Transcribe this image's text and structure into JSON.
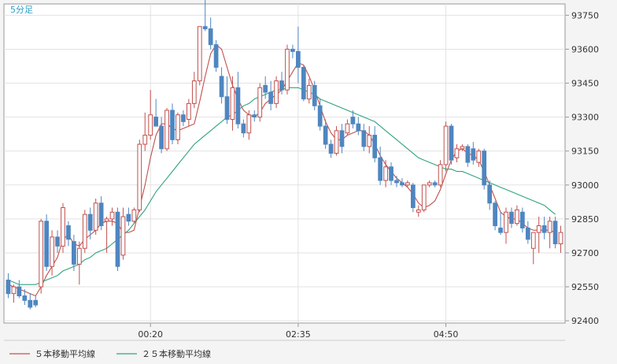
{
  "timeframe_label": "5分足",
  "chart_data": {
    "type": "candlestick",
    "timeframe": "5分足",
    "y_ticks": [
      92400,
      92550,
      92700,
      92850,
      93000,
      93150,
      93300,
      93450,
      93600,
      93750
    ],
    "ylim": [
      92390,
      93800
    ],
    "x_ticks": [
      {
        "label": "00:20",
        "index": 26
      },
      {
        "label": "02:35",
        "index": 53
      },
      {
        "label": "04:50",
        "index": 80
      }
    ],
    "grid": true,
    "legend_position": "bottom-left",
    "up_color": "#ffffff",
    "up_border": "#c0504d",
    "down_color": "#4f86c0",
    "candles": [
      [
        92580,
        92610,
        92500,
        92520
      ],
      [
        92520,
        92560,
        92480,
        92550
      ],
      [
        92550,
        92580,
        92500,
        92510
      ],
      [
        92510,
        92540,
        92470,
        92490
      ],
      [
        92490,
        92520,
        92450,
        92460
      ],
      [
        92490,
        92510,
        92460,
        92470
      ],
      [
        92550,
        92850,
        92520,
        92840
      ],
      [
        92840,
        92870,
        92620,
        92640
      ],
      [
        92640,
        92800,
        92600,
        92770
      ],
      [
        92770,
        92800,
        92700,
        92730
      ],
      [
        92730,
        92920,
        92700,
        92900
      ],
      [
        92820,
        92840,
        92730,
        92760
      ],
      [
        92750,
        92780,
        92620,
        92650
      ],
      [
        92650,
        92750,
        92560,
        92720
      ],
      [
        92720,
        92890,
        92700,
        92870
      ],
      [
        92870,
        92900,
        92760,
        92800
      ],
      [
        92800,
        92940,
        92780,
        92920
      ],
      [
        92920,
        92950,
        92800,
        92820
      ],
      [
        92840,
        92860,
        92700,
        92850
      ],
      [
        92850,
        92900,
        92820,
        92880
      ],
      [
        92880,
        92900,
        92620,
        92640
      ],
      [
        92690,
        92900,
        92670,
        92860
      ],
      [
        92870,
        92900,
        92820,
        92840
      ],
      [
        92840,
        92900,
        92830,
        92890
      ],
      [
        92890,
        93200,
        92880,
        93180
      ],
      [
        93180,
        93320,
        93150,
        93220
      ],
      [
        93220,
        93420,
        93200,
        93310
      ],
      [
        93300,
        93380,
        93260,
        93260
      ],
      [
        93260,
        93300,
        93140,
        93160
      ],
      [
        93160,
        93340,
        93150,
        93330
      ],
      [
        93330,
        93360,
        93180,
        93200
      ],
      [
        93200,
        93320,
        93180,
        93310
      ],
      [
        93310,
        93330,
        93260,
        93280
      ],
      [
        93290,
        93380,
        93260,
        93360
      ],
      [
        93360,
        93500,
        93340,
        93460
      ],
      [
        93460,
        93700,
        93440,
        93700
      ],
      [
        93700,
        93820,
        93680,
        93690
      ],
      [
        93690,
        93740,
        93600,
        93620
      ],
      [
        93620,
        93640,
        93500,
        93520
      ],
      [
        93480,
        93520,
        93360,
        93390
      ],
      [
        93390,
        93480,
        93270,
        93290
      ],
      [
        93290,
        93480,
        93240,
        93430
      ],
      [
        93430,
        93500,
        93250,
        93270
      ],
      [
        93270,
        93290,
        93210,
        93230
      ],
      [
        93230,
        93330,
        93200,
        93310
      ],
      [
        93310,
        93330,
        93280,
        93300
      ],
      [
        93300,
        93450,
        93280,
        93430
      ],
      [
        93440,
        93480,
        93380,
        93410
      ],
      [
        93410,
        93460,
        93330,
        93360
      ],
      [
        93360,
        93480,
        93340,
        93460
      ],
      [
        93460,
        93500,
        93400,
        93420
      ],
      [
        93420,
        93620,
        93400,
        93600
      ],
      [
        93600,
        93620,
        93560,
        93590
      ],
      [
        93590,
        93700,
        93450,
        93520
      ],
      [
        93520,
        93530,
        93370,
        93380
      ],
      [
        93380,
        93470,
        93360,
        93440
      ],
      [
        93440,
        93460,
        93330,
        93350
      ],
      [
        93350,
        93380,
        93240,
        93260
      ],
      [
        93260,
        93290,
        93160,
        93180
      ],
      [
        93180,
        93200,
        93120,
        93140
      ],
      [
        93140,
        93260,
        93130,
        93240
      ],
      [
        93240,
        93270,
        93140,
        93170
      ],
      [
        93230,
        93290,
        93220,
        93270
      ],
      [
        93300,
        93330,
        93250,
        93270
      ],
      [
        93270,
        93300,
        93220,
        93240
      ],
      [
        93240,
        93270,
        93150,
        93170
      ],
      [
        93170,
        93260,
        93140,
        93220
      ],
      [
        93220,
        93260,
        93100,
        93120
      ],
      [
        93120,
        93170,
        93000,
        93020
      ],
      [
        93020,
        93110,
        92990,
        93080
      ],
      [
        93080,
        93100,
        93000,
        93020
      ],
      [
        93020,
        93040,
        92990,
        93010
      ],
      [
        93010,
        93030,
        92990,
        93000
      ],
      [
        93000,
        93020,
        92990,
        93010
      ],
      [
        93000,
        93010,
        92880,
        92900
      ],
      [
        92880,
        92910,
        92860,
        92890
      ],
      [
        92890,
        92990,
        92880,
        93000
      ],
      [
        93000,
        93020,
        92990,
        93010
      ],
      [
        93010,
        93020,
        92990,
        93000
      ],
      [
        93000,
        93110,
        92990,
        93090
      ],
      [
        93090,
        93280,
        93060,
        93260
      ],
      [
        93260,
        93270,
        93090,
        93110
      ],
      [
        93120,
        93180,
        93100,
        93160
      ],
      [
        93160,
        93180,
        93150,
        93170
      ],
      [
        93170,
        93180,
        93080,
        93100
      ],
      [
        93160,
        93190,
        93090,
        93110
      ],
      [
        93100,
        93160,
        93080,
        93150
      ],
      [
        93150,
        93160,
        92980,
        93000
      ],
      [
        93000,
        93020,
        92890,
        92920
      ],
      [
        92920,
        92930,
        92800,
        92820
      ],
      [
        92810,
        92880,
        92780,
        92790
      ],
      [
        92790,
        92900,
        92740,
        92880
      ],
      [
        92880,
        92900,
        92810,
        92830
      ],
      [
        92830,
        92910,
        92820,
        92890
      ],
      [
        92880,
        92900,
        92790,
        92810
      ],
      [
        92810,
        92840,
        92740,
        92760
      ],
      [
        92720,
        92790,
        92650,
        92790
      ],
      [
        92790,
        92860,
        92700,
        92820
      ],
      [
        92820,
        92860,
        92760,
        92790
      ],
      [
        92790,
        92860,
        92720,
        92840
      ],
      [
        92840,
        92860,
        92720,
        92740
      ],
      [
        92740,
        92820,
        92700,
        92790
      ]
    ],
    "series": [
      {
        "name": "５本移動平均線",
        "color": "#c0504d",
        "values": [
          92560,
          92550,
          92540,
          92530,
          92520,
          92510,
          92550,
          92600,
          92640,
          92680,
          92760,
          92780,
          92740,
          92730,
          92760,
          92780,
          92800,
          92830,
          92840,
          92840,
          92830,
          92790,
          92790,
          92800,
          92900,
          93000,
          93120,
          93220,
          93270,
          93270,
          93250,
          93240,
          93250,
          93260,
          93270,
          93370,
          93480,
          93580,
          93620,
          93600,
          93520,
          93440,
          93380,
          93330,
          93310,
          93300,
          93320,
          93360,
          93380,
          93400,
          93420,
          93460,
          93500,
          93540,
          93530,
          93480,
          93420,
          93350,
          93280,
          93230,
          93200,
          93200,
          93220,
          93230,
          93240,
          93240,
          93220,
          93180,
          93130,
          93090,
          93060,
          93030,
          93010,
          92990,
          92960,
          92920,
          92900,
          92910,
          92930,
          92980,
          93050,
          93110,
          93150,
          93160,
          93140,
          93130,
          93110,
          93060,
          93000,
          92940,
          92880,
          92860,
          92850,
          92850,
          92830,
          92810,
          92800,
          92800,
          92800,
          92800,
          92790
        ]
      },
      {
        "name": "２５本移動平均線",
        "color": "#2fa37f",
        "values": [
          92580,
          92570,
          92560,
          92560,
          92560,
          92560,
          92570,
          92580,
          92590,
          92600,
          92620,
          92630,
          92640,
          92650,
          92670,
          92680,
          92700,
          92710,
          92720,
          92740,
          92760,
          92780,
          92800,
          92830,
          92860,
          92890,
          92930,
          92970,
          93000,
          93030,
          93060,
          93090,
          93120,
          93150,
          93180,
          93200,
          93220,
          93240,
          93260,
          93280,
          93300,
          93310,
          93330,
          93350,
          93360,
          93380,
          93390,
          93400,
          93410,
          93420,
          93420,
          93430,
          93430,
          93430,
          93420,
          93410,
          93400,
          93380,
          93370,
          93360,
          93350,
          93340,
          93330,
          93320,
          93310,
          93300,
          93290,
          93280,
          93260,
          93240,
          93220,
          93200,
          93180,
          93160,
          93140,
          93120,
          93110,
          93100,
          93090,
          93080,
          93070,
          93070,
          93060,
          93060,
          93050,
          93040,
          93030,
          93020,
          93010,
          93000,
          92990,
          92980,
          92970,
          92960,
          92950,
          92940,
          92930,
          92920,
          92910,
          92890,
          92870
        ]
      }
    ]
  }
}
